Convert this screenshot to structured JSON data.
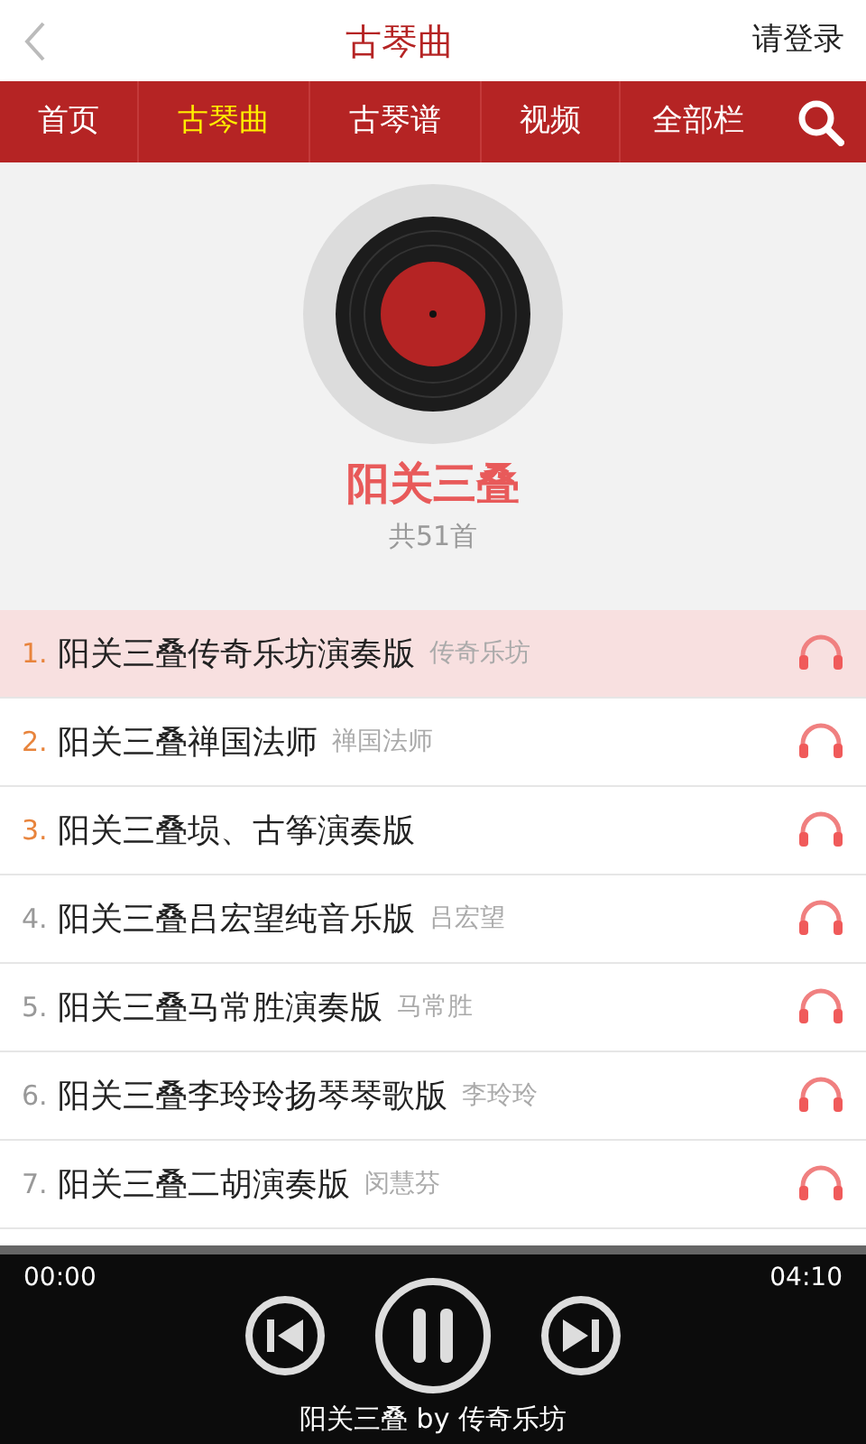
{
  "header": {
    "title": "古琴曲",
    "login": "请登录"
  },
  "nav": [
    {
      "label": "首页",
      "selected": false
    },
    {
      "label": "古琴曲",
      "selected": true
    },
    {
      "label": "古琴谱",
      "selected": false
    },
    {
      "label": "视频",
      "selected": false
    },
    {
      "label": "全部栏",
      "selected": false
    }
  ],
  "album": {
    "title": "阳关三叠",
    "count": "共51首"
  },
  "tracks": [
    {
      "number": "1.",
      "title": "阳关三叠传奇乐坊演奏版",
      "artist": "传奇乐坊",
      "color": "#e8843c",
      "selected": true
    },
    {
      "number": "2.",
      "title": "阳关三叠禅国法师",
      "artist": "禅国法师",
      "color": "#e8843c",
      "selected": false
    },
    {
      "number": "3.",
      "title": "阳关三叠埙、古筝演奏版",
      "color": "#e8843c",
      "selected": false
    },
    {
      "number": "4.",
      "title": "阳关三叠吕宏望纯音乐版",
      "artist": "吕宏望",
      "color": "#999999",
      "selected": false
    },
    {
      "number": "5.",
      "title": "阳关三叠马常胜演奏版",
      "artist": "马常胜",
      "color": "#999999",
      "selected": false
    },
    {
      "number": "6.",
      "title": "阳关三叠李玲玲扬琴琴歌版",
      "artist": "李玲玲",
      "color": "#999999",
      "selected": false
    },
    {
      "number": "7.",
      "title": "阳关三叠二胡演奏版",
      "artist": "闵慧芬",
      "color": "#999999",
      "selected": false
    }
  ],
  "player": {
    "elapsed": "00:00",
    "duration": "04:10",
    "playing": true,
    "caption": "阳关三叠 by 传奇乐坊"
  }
}
